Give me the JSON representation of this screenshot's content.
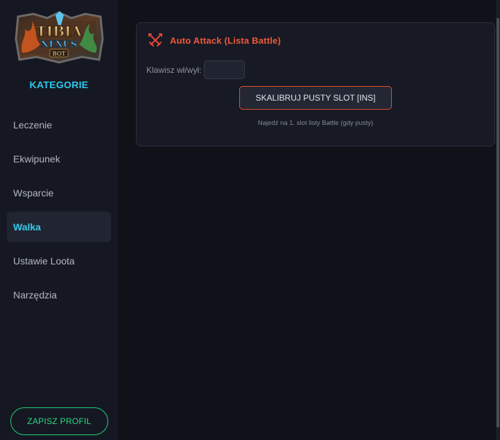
{
  "sidebar": {
    "category_title": "KATEGORIE",
    "items": [
      {
        "label": "Leczenie",
        "active": false
      },
      {
        "label": "Ekwipunek",
        "active": false
      },
      {
        "label": "Wsparcie",
        "active": false
      },
      {
        "label": "Walka",
        "active": true
      },
      {
        "label": "Ustawie Loota",
        "active": false
      },
      {
        "label": "Narzędzia",
        "active": false
      }
    ],
    "save_label": "ZAPISZ PROFIL"
  },
  "logo": {
    "line1": "TIBIA",
    "line2": "NEXUS",
    "line3": "BOT"
  },
  "card": {
    "icon": "crossed-swords-icon",
    "title": "Auto Attack (Lista Battle)",
    "key_label": "Klawisz wł/wył:",
    "key_value": "",
    "calibrate_label": "SKALIBRUJ PUSTY SLOT [INS]",
    "hint": "Najedź na 1. slot listy Battle (gdy pusty)"
  },
  "colors": {
    "accent_cyan": "#2ec9ef",
    "accent_red": "#f0583a",
    "accent_green": "#1fd27a",
    "background": "#10121a",
    "sidebar": "#151822"
  }
}
